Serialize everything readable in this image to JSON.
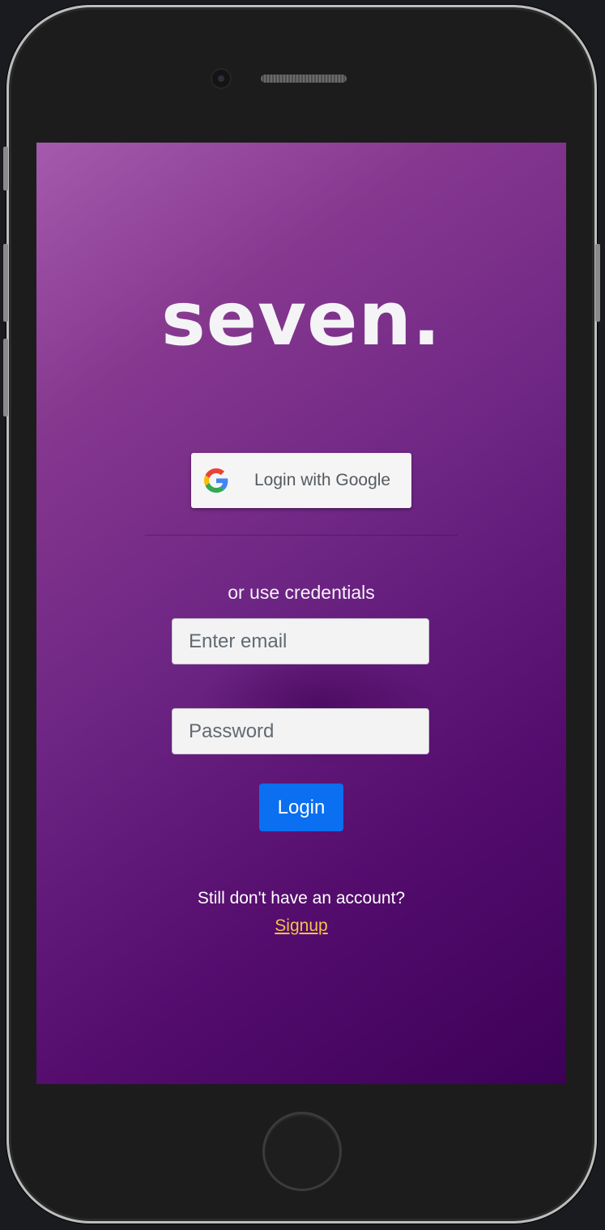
{
  "brand": {
    "logo_text": "seven."
  },
  "google": {
    "label": "Login with Google"
  },
  "divider_text": "or use credentials",
  "form": {
    "email": {
      "placeholder": "Enter email",
      "value": ""
    },
    "password": {
      "placeholder": "Password",
      "value": ""
    },
    "login_label": "Login"
  },
  "footer": {
    "prompt": "Still don't have an account?",
    "signup_label": "Signup"
  },
  "colors": {
    "gradient_top": "#a45aad",
    "gradient_bottom": "#3d0158",
    "login_button": "#0a6ff0",
    "signup_link": "#f5c04a"
  },
  "icons": [
    "google-icon",
    "camera-icon",
    "home-button-icon"
  ]
}
